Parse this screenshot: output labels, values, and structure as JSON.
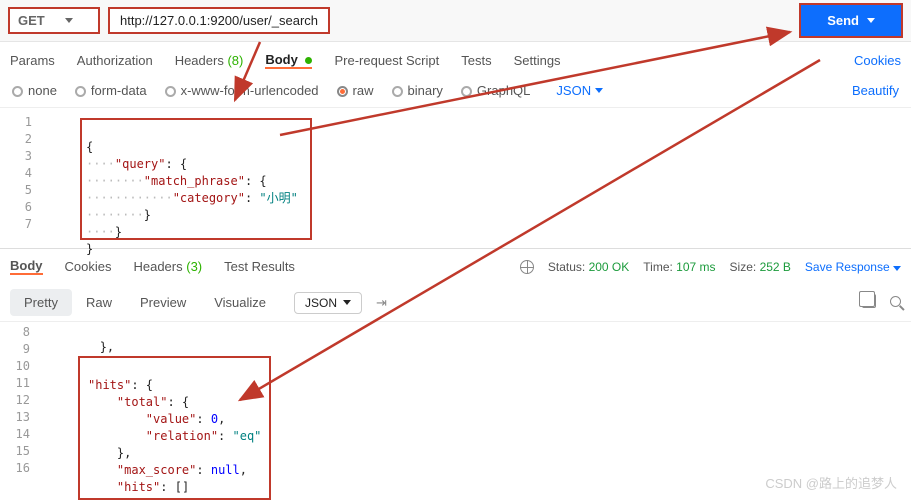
{
  "request": {
    "method": "GET",
    "url": "http://127.0.0.1:9200/user/_search",
    "sendLabel": "Send"
  },
  "reqTabs": {
    "params": "Params",
    "auth": "Authorization",
    "headers": "Headers",
    "headersCount": "(8)",
    "body": "Body",
    "prereq": "Pre-request Script",
    "tests": "Tests",
    "settings": "Settings",
    "cookies": "Cookies"
  },
  "bodyTypes": {
    "none": "none",
    "formdata": "form-data",
    "xwww": "x-www-form-urlencoded",
    "raw": "raw",
    "binary": "binary",
    "graphql": "GraphQL",
    "json": "JSON",
    "beautify": "Beautify"
  },
  "reqLines": [
    "1",
    "2",
    "3",
    "4",
    "5",
    "6",
    "7"
  ],
  "reqCode": {
    "l1o": "{",
    "l2k": "\"query\"",
    "l2c": ": {",
    "l3k": "\"match_phrase\"",
    "l3c": ": {",
    "l4k": "\"category\"",
    "l4c": ": ",
    "l4v": "\"小明\"",
    "l5": "}",
    "l6": "}",
    "l7": "}"
  },
  "resTabs": {
    "body": "Body",
    "cookies": "Cookies",
    "headers": "Headers",
    "headersCount": "(3)",
    "tests": "Test Results",
    "statusLbl": "Status:",
    "status": "200 OK",
    "timeLbl": "Time:",
    "time": "107 ms",
    "sizeLbl": "Size:",
    "size": "252 B",
    "save": "Save Response"
  },
  "view": {
    "pretty": "Pretty",
    "raw": "Raw",
    "preview": "Preview",
    "visualize": "Visualize",
    "fmt": "JSON"
  },
  "resLines": [
    "8",
    "9",
    "10",
    "11",
    "12",
    "13",
    "14",
    "15",
    "16"
  ],
  "resCode": {
    "l9": "},",
    "l10k": "\"hits\"",
    "l10c": ": {",
    "l11k": "\"total\"",
    "l11c": ": {",
    "l12k": "\"value\"",
    "l12c": ": ",
    "l12v": "0",
    "l12e": ",",
    "l13k": "\"relation\"",
    "l13c": ": ",
    "l13v": "\"eq\"",
    "l14": "},",
    "l15k": "\"max_score\"",
    "l15c": ": ",
    "l15v": "null",
    "l15e": ",",
    "l16k": "\"hits\"",
    "l16c": ": []"
  },
  "watermark": "CSDN @路上的追梦人"
}
